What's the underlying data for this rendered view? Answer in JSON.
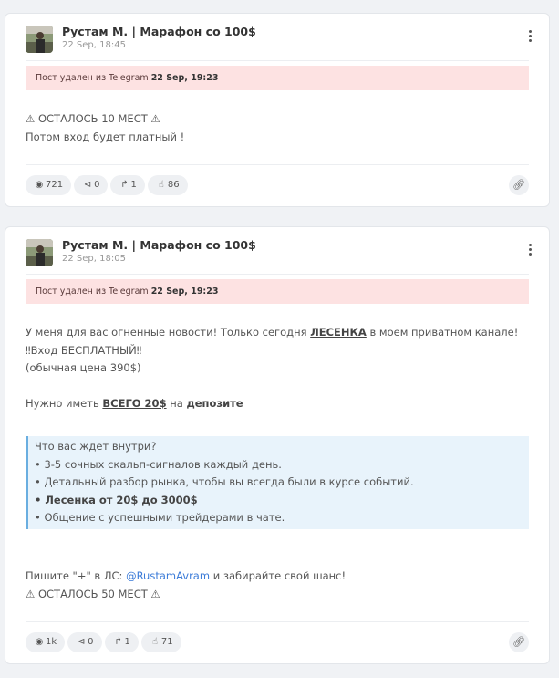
{
  "posts": [
    {
      "author": "Рустам М. | Марафон со 100$",
      "time": "22 Sep, 18:45",
      "deleted_prefix": "Пост удален из Telegram ",
      "deleted_date": "22 Sep, 19:23",
      "lines": [
        "⚠ ОСТАЛОСЬ 10 МЕСТ ⚠",
        "Потом вход будет платный !"
      ],
      "stats": {
        "views": "721",
        "shares": "0",
        "forwards": "1",
        "likes": "86"
      }
    },
    {
      "author": "Рустам М. | Марафон со 100$",
      "time": "22 Sep, 18:05",
      "deleted_prefix": "Пост удален из Telegram ",
      "deleted_date": "22 Sep, 19:23",
      "intro_a": "У меня для вас огненные новости! Только сегодня ",
      "intro_link": "ЛЕСЕНКА",
      "intro_b": " в моем приватном канале!",
      "free_line": "‼Вход БЕСПЛАТНЫЙ‼",
      "price_line": "(обычная цена 390$)",
      "need_a": "Нужно иметь ",
      "need_amount": "ВСЕГО 20$",
      "need_b": " на ",
      "need_deposit": "депозите",
      "quote": {
        "title": "Что вас ждет внутри?",
        "item1": "• 3-5 сочных скальп-сигналов каждый день.",
        "item2": "• Детальный разбор рынка, чтобы вы всегда были в курсе событий.",
        "item3": "• Лесенка от 20$ до 3000$",
        "item4": "• Общение с успешными трейдерами в чате."
      },
      "write_a": "Пишите \"+\" в ЛС: ",
      "write_handle": "@RustamAvram",
      "write_b": " и забирайте свой шанс!",
      "last_line": "⚠ ОСТАЛОСЬ 50 МЕСТ ⚠",
      "stats": {
        "views": "1k",
        "shares": "0",
        "forwards": "1",
        "likes": "71"
      }
    }
  ],
  "icons": {
    "views": "eye-icon",
    "shares": "share-icon",
    "forwards": "forward-icon",
    "likes": "thumbs-up-icon",
    "link": "link-icon",
    "menu": "more-vertical-icon"
  },
  "colors": {
    "alert_bg": "#fde2e2",
    "quote_border": "#6aaee0",
    "link": "#3b7bd8"
  }
}
